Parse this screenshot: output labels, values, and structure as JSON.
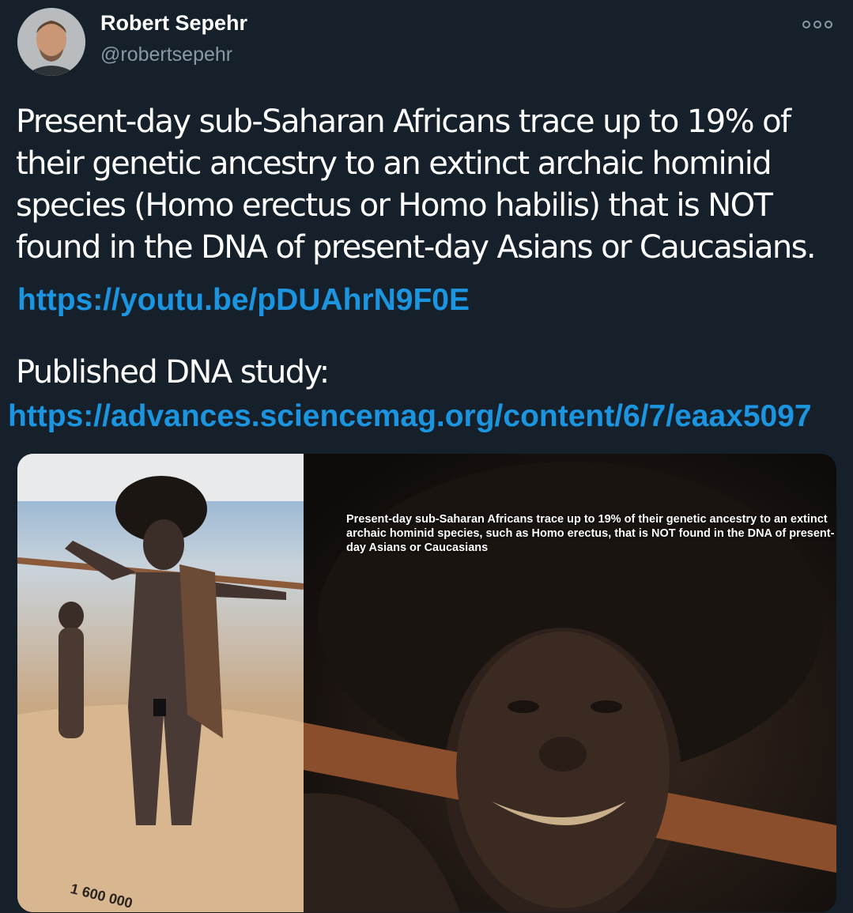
{
  "author": {
    "name": "Robert Sepehr",
    "handle": "@robertsepehr"
  },
  "icons": {
    "more": "more-horizontal-icon",
    "avatar": "profile-photo"
  },
  "tweet": {
    "text": "Present-day sub-Saharan Africans trace up to 19% of their genetic ancestry to an extinct archaic hominid species (Homo erectus or Homo habilis) that is NOT found in the DNA of present-day Asians or Caucasians.",
    "link1": "https://youtu.be/pDUAhrN9F0E",
    "published_label": "Published DNA study:",
    "link2": "https://advances.sciencemag.org/content/6/7/eaax5097"
  },
  "media": {
    "overlay_text": "Present-day sub-Saharan Africans trace up to 19% of their genetic ancestry to an extinct archaic hominid species, such as Homo erectus, that is NOT found in the DNA of present-day Asians or Caucasians",
    "plaque_text": "1 600 000"
  },
  "colors": {
    "background": "#15202b",
    "link": "#1b95e0",
    "secondary_text": "#8899a6"
  }
}
